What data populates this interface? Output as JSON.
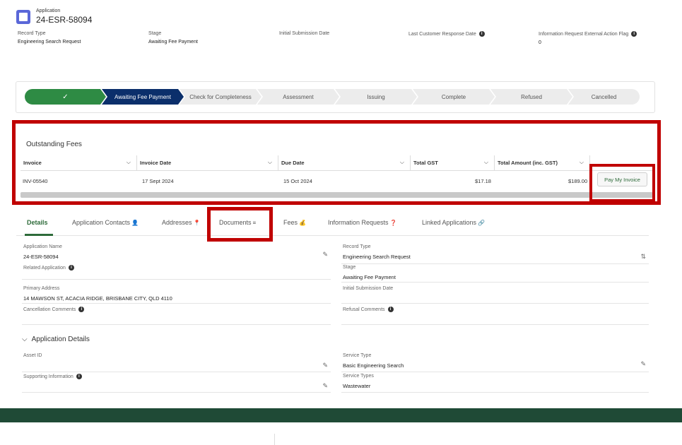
{
  "header": {
    "object_type": "Application",
    "record_number": "24-ESR-58094",
    "fields": [
      {
        "label": "Record Type",
        "value": "Engineering Search Request",
        "info": false
      },
      {
        "label": "Stage",
        "value": "Awaiting Fee Payment",
        "info": false
      },
      {
        "label": "Initial Submission Date",
        "value": "",
        "info": false
      },
      {
        "label": "Last Customer Response Date",
        "value": "",
        "info": true
      },
      {
        "label": "Information Request External Action Flag",
        "value": "0",
        "info": true
      }
    ]
  },
  "path": {
    "steps": [
      {
        "label": "✓",
        "state": "complete"
      },
      {
        "label": "Awaiting Fee Payment",
        "state": "current"
      },
      {
        "label": "Check for Completeness",
        "state": "incomplete"
      },
      {
        "label": "Assessment",
        "state": "incomplete"
      },
      {
        "label": "Issuing",
        "state": "incomplete"
      },
      {
        "label": "Complete",
        "state": "incomplete"
      },
      {
        "label": "Refused",
        "state": "incomplete"
      },
      {
        "label": "Cancelled",
        "state": "incomplete"
      }
    ]
  },
  "fees": {
    "title": "Outstanding Fees",
    "columns": [
      "Invoice",
      "Invoice Date",
      "Due Date",
      "Total GST",
      "Total Amount (inc. GST)"
    ],
    "rows": [
      {
        "invoice": "INV-05540",
        "invoice_date": "17 Sept 2024",
        "due_date": "15 Oct 2024",
        "gst": "$17.18",
        "total": "$189.00"
      }
    ],
    "pay_button": "Pay My Invoice"
  },
  "tabs": [
    {
      "label": "Details",
      "badge": ""
    },
    {
      "label": "Application Contacts",
      "badge": "👤"
    },
    {
      "label": "Addresses",
      "badge": "📍"
    },
    {
      "label": "Documents",
      "badge": "≡"
    },
    {
      "label": "Fees",
      "badge": "💰"
    },
    {
      "label": "Information Requests",
      "badge": "❓"
    },
    {
      "label": "Linked Applications",
      "badge": "🔗"
    }
  ],
  "details": {
    "application_name_label": "Application Name",
    "application_name": "24-ESR-58094",
    "related_application_label": "Related Application",
    "record_type_label": "Record Type",
    "record_type": "Engineering Search Request",
    "stage_label": "Stage",
    "stage": "Awaiting Fee Payment",
    "primary_address_label": "Primary Address",
    "primary_address": "14 MAWSON ST, ACACIA RIDGE, BRISBANE CITY, QLD 4110",
    "initial_submission_label": "Initial Submission Date",
    "cancellation_label": "Cancellation Comments",
    "refusal_label": "Refusal Comments"
  },
  "application_details": {
    "title": "Application Details",
    "asset_id_label": "Asset ID",
    "service_type_label": "Service Type",
    "service_type": "Basic Engineering Search",
    "supporting_info_label": "Supporting Information",
    "service_types_label": "Service Types",
    "service_types": "Wastewater"
  }
}
